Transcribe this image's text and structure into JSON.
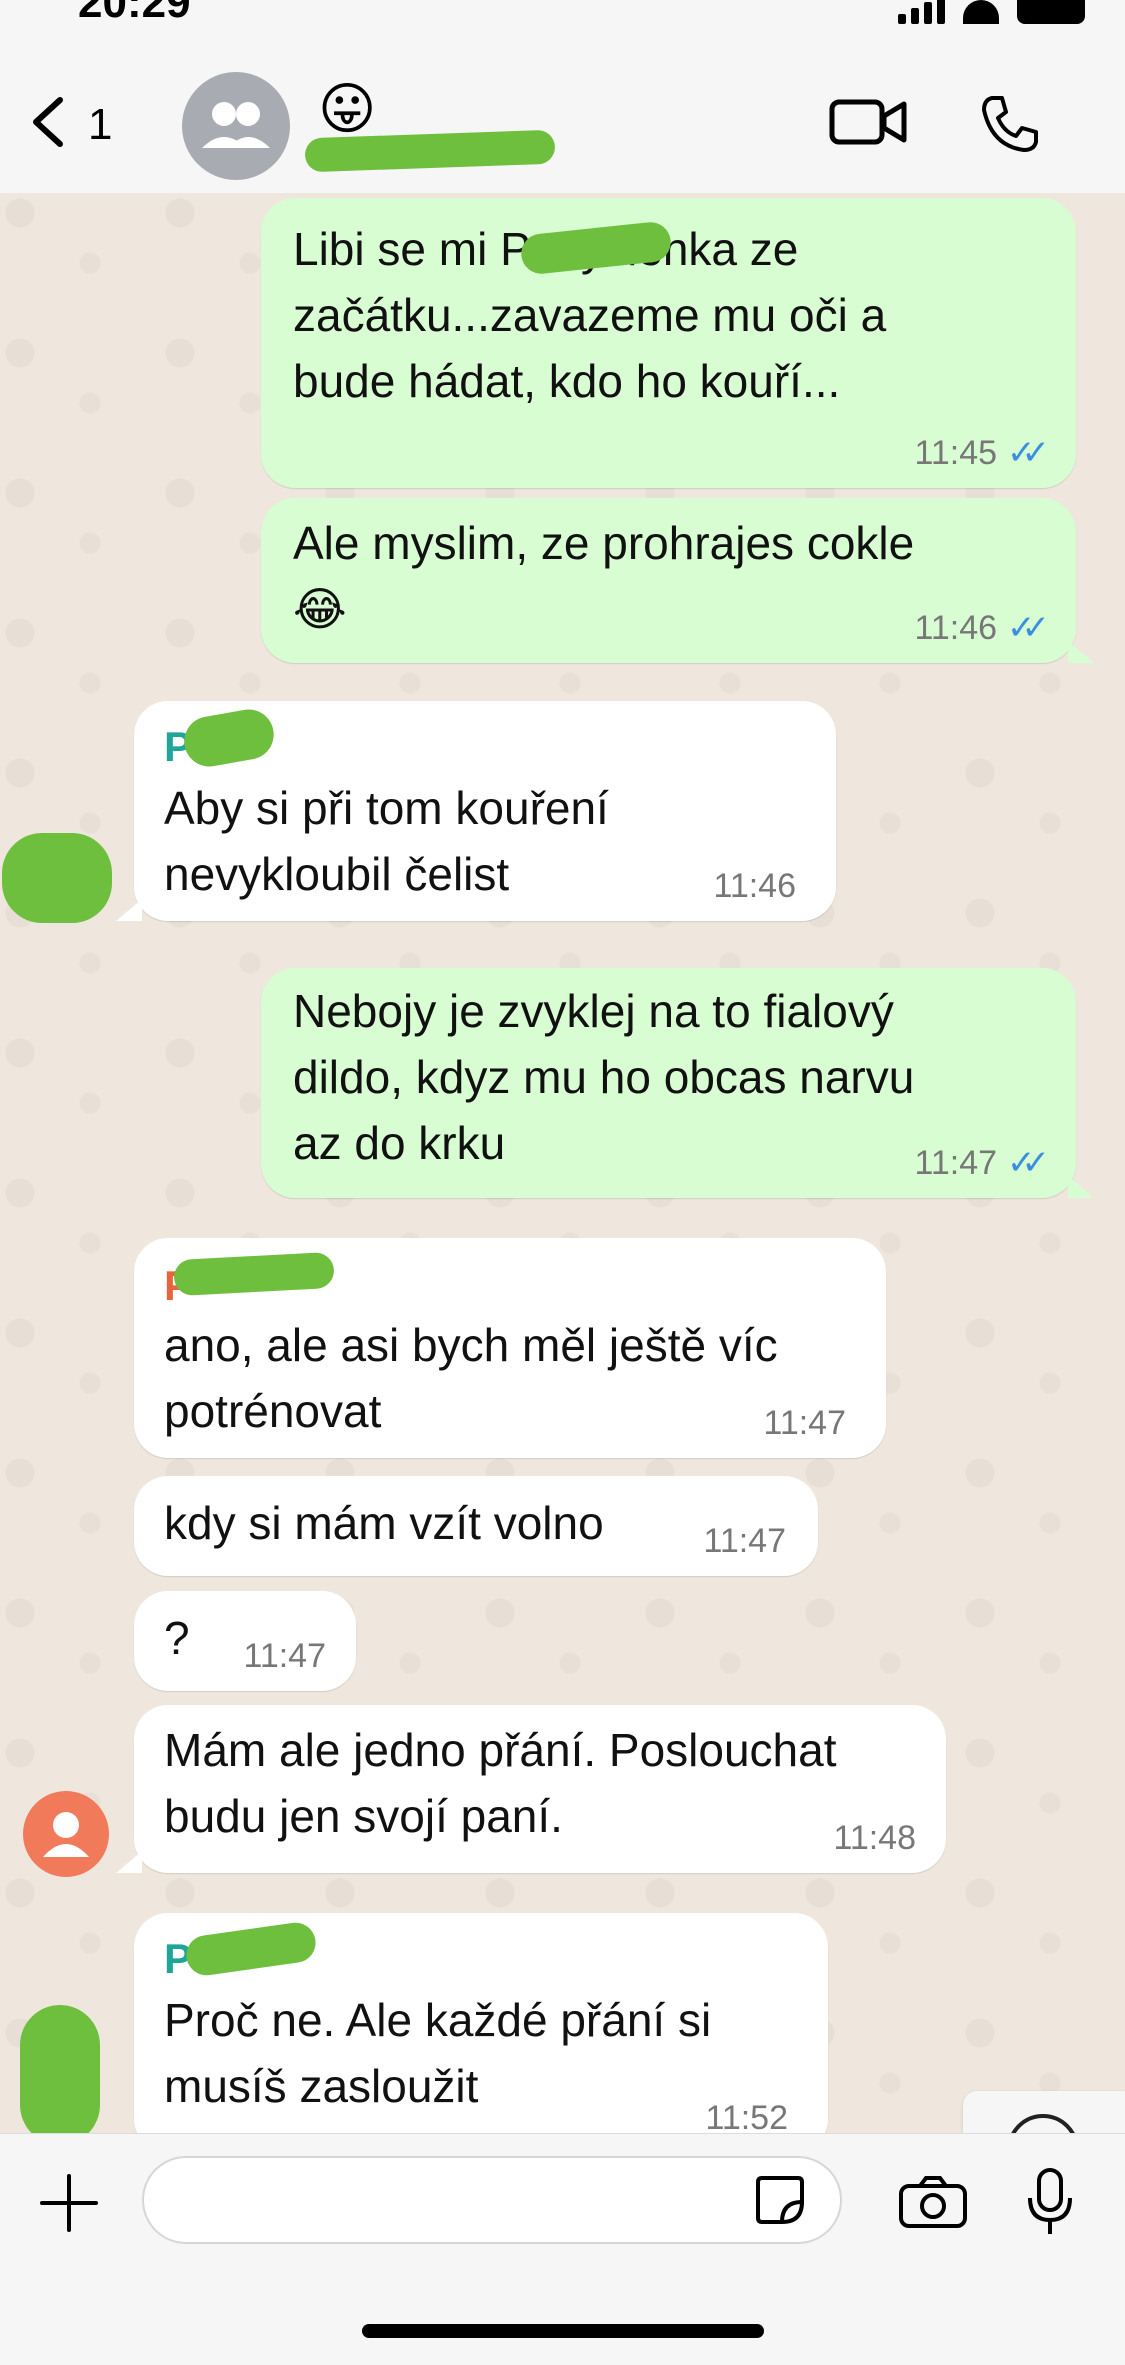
{
  "status_bar": {
    "time": "20:29"
  },
  "header": {
    "back_count": "1",
    "title_emoji": "😛",
    "icons": [
      "chevron-left-icon",
      "group-avatar-icon",
      "video-call-icon",
      "phone-icon"
    ]
  },
  "messages": [
    {
      "dir": "out",
      "text": "Libi se mi P         myšlenka ze\nzačátku...zavazeme mu oči a\nbude hádat, kdo ho kouří...",
      "time": "11:45",
      "read": true
    },
    {
      "dir": "out",
      "text": "Ale myslim, ze prohrajes cokle\n😂",
      "time": "11:46",
      "read": true
    },
    {
      "dir": "in",
      "sender": "P",
      "sender_color": "#1fa59a",
      "text": "Aby si při tom kouření\nnevykloubil čelist",
      "time": "11:46"
    },
    {
      "dir": "out",
      "text": "Nebojy je zvyklej na to fialový\ndildo, kdyz mu ho obcas narvu\naz do krku",
      "time": "11:47",
      "read": true
    },
    {
      "dir": "in",
      "sender": "P",
      "sender_color": "#e8643c",
      "text": "ano, ale asi bych měl ještě víc\npotrénovat",
      "time": "11:47"
    },
    {
      "dir": "in",
      "text": "kdy si mám vzít volno",
      "time": "11:47"
    },
    {
      "dir": "in",
      "text": "?",
      "time": "11:47"
    },
    {
      "dir": "in",
      "text": "Mám ale jedno přání. Poslouchat\nbudu jen svojí paní.",
      "time": "11:48"
    },
    {
      "dir": "in",
      "sender": "P",
      "sender_color": "#1fa59a",
      "text": "Proč ne.  Ale každé přání si\nmusíš zasloužit",
      "time": "11:52"
    }
  ],
  "input": {
    "placeholder": ""
  },
  "colors": {
    "outgoing": "#d9fdd3",
    "incoming": "#ffffff",
    "read_ticks": "#3a8fe0",
    "redaction": "#6fbf3f"
  }
}
